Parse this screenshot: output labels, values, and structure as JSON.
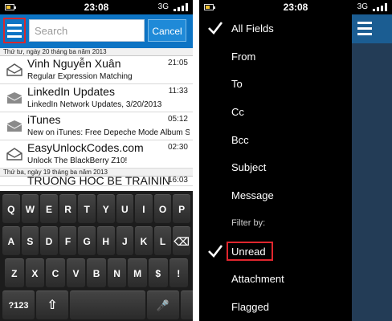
{
  "colors": {
    "accent": "#0d74c4",
    "highlight": "#e0262e"
  },
  "left": {
    "status": {
      "time": "23:08",
      "network": "3G"
    },
    "header": {
      "search_placeholder": "Search",
      "cancel_label": "Cancel"
    },
    "groups": [
      {
        "date": "Thứ tư, ngày 20 tháng ba năm 2013",
        "messages": [
          {
            "sender": "Vinh Nguyễn Xuân",
            "time": "21:05",
            "subject": "Regular Expression Matching"
          },
          {
            "sender": "LinkedIn Updates",
            "time": "11:33",
            "subject": "LinkedIn Network Updates, 3/20/2013"
          },
          {
            "sender": "iTunes",
            "time": "05:12",
            "subject": "New on iTunes: Free Depeche Mode Album S"
          },
          {
            "sender": "EasyUnlockCodes.com",
            "time": "02:30",
            "subject": "Unlock The BlackBerry Z10!"
          }
        ]
      },
      {
        "date": "Thứ ba, ngày 19 tháng ba năm 2013",
        "messages": [
          {
            "sender": "TRUONG HOC BE TRAININ",
            "time": "16:03",
            "subject": ""
          }
        ]
      }
    ],
    "keyboard": {
      "row1": [
        "Q",
        "W",
        "E",
        "R",
        "T",
        "Y",
        "U",
        "I",
        "O",
        "P"
      ],
      "row2": [
        "A",
        "S",
        "D",
        "F",
        "G",
        "H",
        "J",
        "K",
        "L",
        "⌫"
      ],
      "row3": [
        "Z",
        "X",
        "C",
        "V",
        "B",
        "N",
        "M",
        "$",
        "!"
      ],
      "row4": {
        "sym": "?123",
        "shift": "⇧",
        "space": "",
        "mic": "🎤",
        "enter": "↵"
      }
    }
  },
  "right": {
    "status": {
      "time": "23:08",
      "network": "3G"
    },
    "fields": [
      {
        "label": "All Fields",
        "checked": true
      },
      {
        "label": "From",
        "checked": false
      },
      {
        "label": "To",
        "checked": false
      },
      {
        "label": "Cc",
        "checked": false
      },
      {
        "label": "Bcc",
        "checked": false
      },
      {
        "label": "Subject",
        "checked": false
      },
      {
        "label": "Message",
        "checked": false
      }
    ],
    "filter_header": "Filter by:",
    "filters": [
      {
        "label": "Unread",
        "checked": true
      },
      {
        "label": "Attachment",
        "checked": false
      },
      {
        "label": "Flagged",
        "checked": false
      }
    ]
  }
}
